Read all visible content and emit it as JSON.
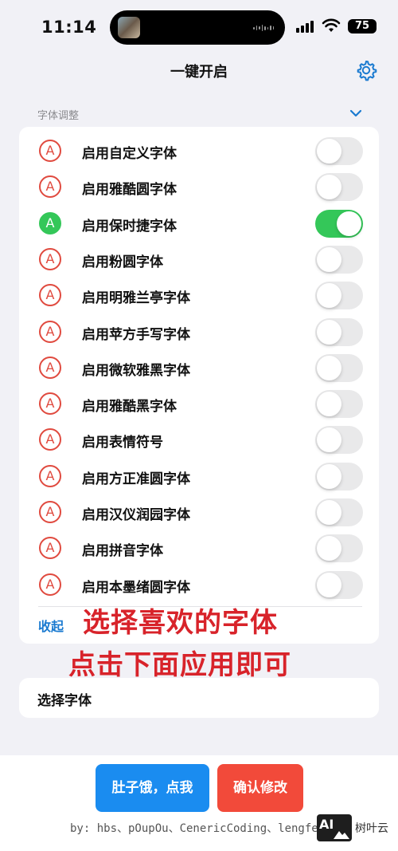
{
  "status": {
    "time": "11:14",
    "battery": "75"
  },
  "nav": {
    "title": "一键开启",
    "settings_icon": "gear-icon"
  },
  "section": {
    "header": "字体调整",
    "collapse_label": "收起"
  },
  "badge_letter": "A",
  "fonts": [
    {
      "label": "启用自定义字体",
      "enabled": false
    },
    {
      "label": "启用雅酷圆字体",
      "enabled": false
    },
    {
      "label": "启用保时捷字体",
      "enabled": true
    },
    {
      "label": "启用粉圆字体",
      "enabled": false
    },
    {
      "label": "启用明雅兰亭字体",
      "enabled": false
    },
    {
      "label": "启用苹方手写字体",
      "enabled": false
    },
    {
      "label": "启用微软雅黑字体",
      "enabled": false
    },
    {
      "label": "启用雅酷黑字体",
      "enabled": false
    },
    {
      "label": "启用表情符号",
      "enabled": false
    },
    {
      "label": "启用方正准圆字体",
      "enabled": false
    },
    {
      "label": "启用汉仪润园字体",
      "enabled": false
    },
    {
      "label": "启用拼音字体",
      "enabled": false
    },
    {
      "label": "启用本墨绪圆字体",
      "enabled": false
    }
  ],
  "overlay": {
    "line1": "选择喜欢的字体",
    "line2": "点击下面应用即可"
  },
  "select_font": {
    "label": "选择字体"
  },
  "actions": {
    "hungry_label": "肚子饿，点我",
    "confirm_label": "确认修改"
  },
  "credits": "by: hbs、pOupOu、CenericCoding、lengfen",
  "watermark": {
    "logo_text": "AI",
    "name": "树叶云"
  },
  "colors": {
    "accent_blue": "#1a7ad0",
    "toggle_on": "#34c759",
    "badge_red": "#e04a3f",
    "button_blue": "#1a8cf0",
    "button_red": "#f24a3a",
    "overlay_red": "#d8232a"
  }
}
